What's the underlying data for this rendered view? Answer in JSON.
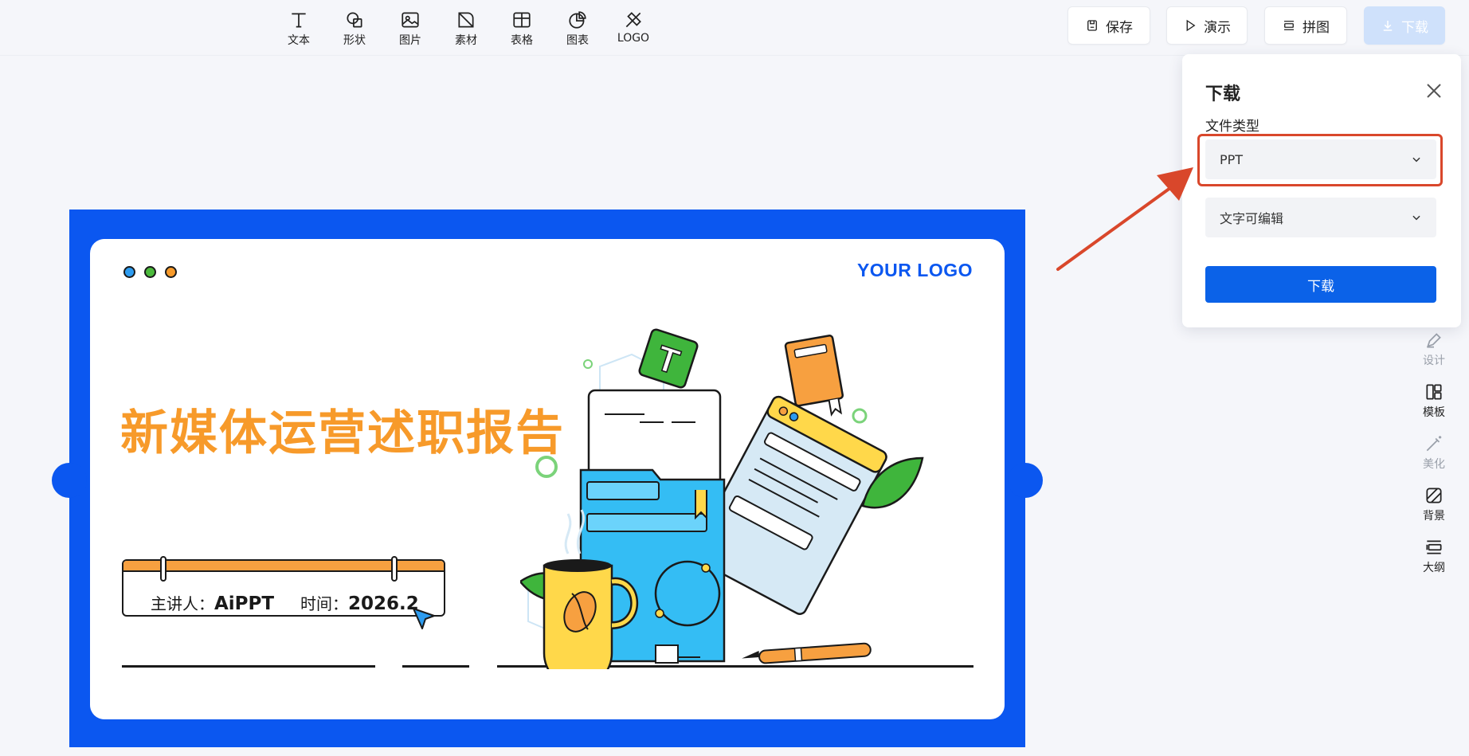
{
  "toolbar": {
    "tools": [
      {
        "label": "文本",
        "icon": "text-icon"
      },
      {
        "label": "形状",
        "icon": "shape-icon"
      },
      {
        "label": "图片",
        "icon": "image-icon"
      },
      {
        "label": "素材",
        "icon": "asset-icon"
      },
      {
        "label": "表格",
        "icon": "table-icon"
      },
      {
        "label": "图表",
        "icon": "chart-icon"
      },
      {
        "label": "LOGO",
        "icon": "logo-icon"
      }
    ],
    "save_label": "保存",
    "present_label": "演示",
    "collage_label": "拼图",
    "download_label": "下载"
  },
  "slide": {
    "logo": "YOUR LOGO",
    "title": "新媒体运营述职报告",
    "presenter_label": "主讲人：",
    "presenter": "AiPPT",
    "time_label": "时间：",
    "time": "2026.2",
    "badge_letter": "T",
    "dot_colors": [
      "#2d9cf0",
      "#4cba3c",
      "#f79a2a"
    ]
  },
  "sidebar": {
    "items": [
      {
        "label": "设计",
        "icon": "pen-icon",
        "muted": true
      },
      {
        "label": "模板",
        "icon": "template-icon",
        "muted": false
      },
      {
        "label": "美化",
        "icon": "magic-wand-icon",
        "muted": true
      },
      {
        "label": "背景",
        "icon": "background-icon",
        "muted": false
      },
      {
        "label": "大纲",
        "icon": "outline-icon",
        "muted": false
      }
    ]
  },
  "download_panel": {
    "title": "下载",
    "file_type_label": "文件类型",
    "file_type_value": "PPT",
    "edit_mode_value": "文字可编辑",
    "download_button": "下载"
  },
  "colors": {
    "accent": "#0b57f0",
    "title_orange": "#f79a2a",
    "highlight_red": "#d9472b"
  }
}
